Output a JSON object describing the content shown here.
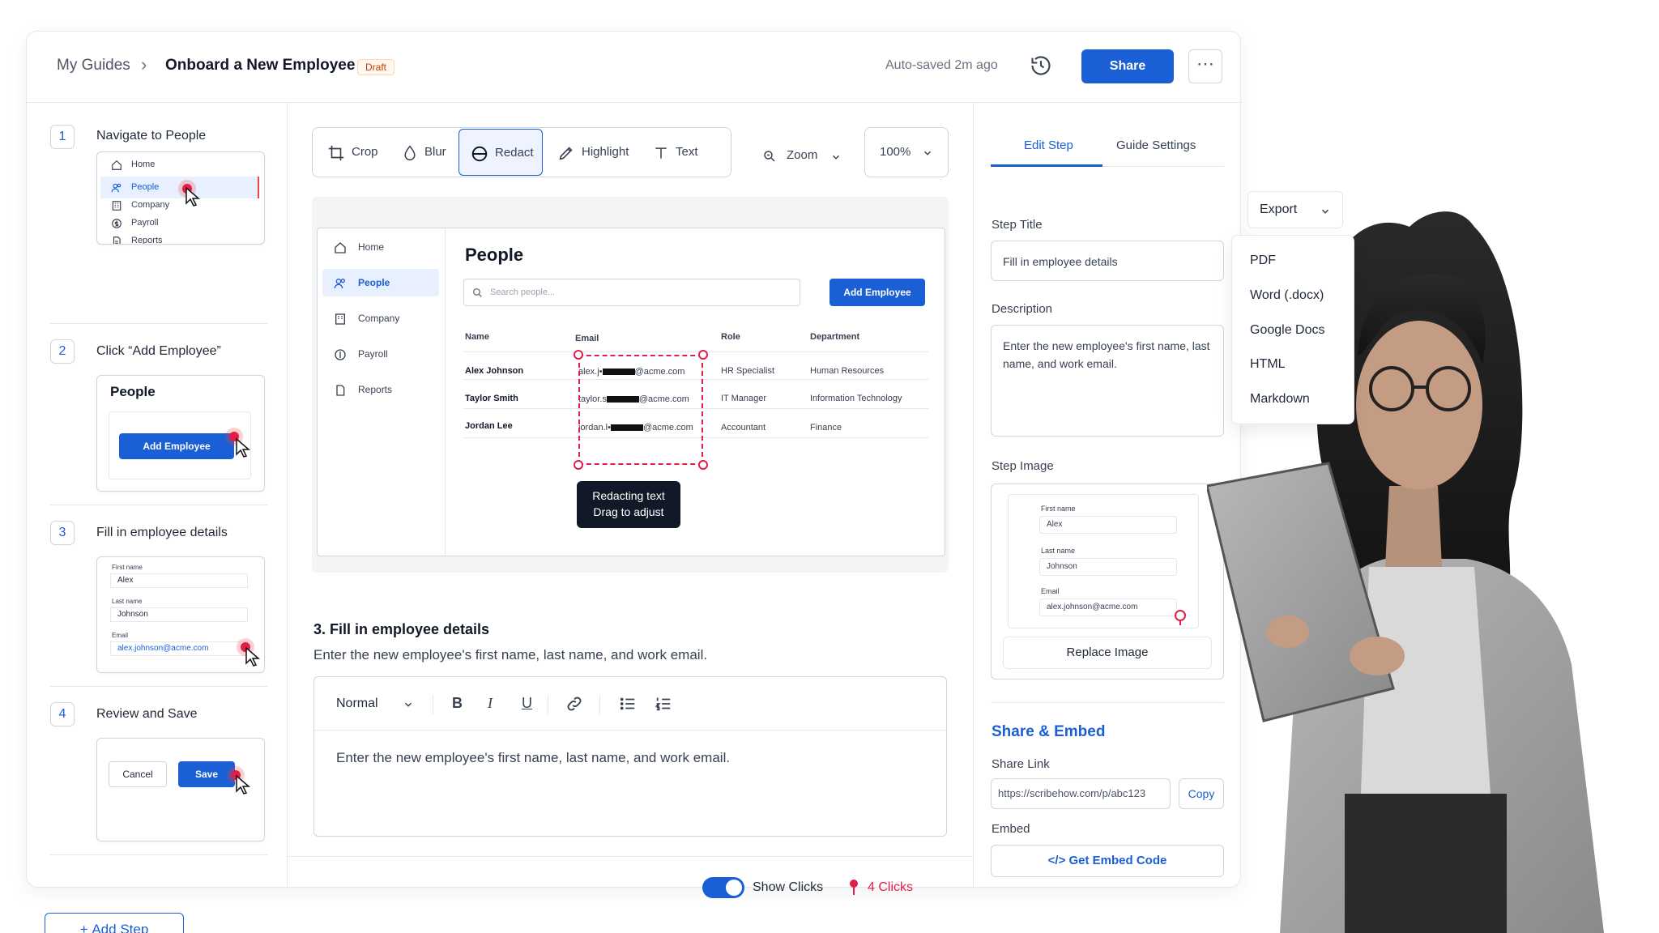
{
  "header": {
    "breadcrumb_root": "My Guides",
    "breadcrumb_sep": "›",
    "guide_title": "Onboard a New Employee",
    "status_badge": "Draft",
    "autosave": "Auto-saved 2m ago",
    "share_label": "Share",
    "more_label": "⋯"
  },
  "steps": [
    {
      "num": "1",
      "label": "Navigate to People"
    },
    {
      "num": "2",
      "label": "Click “Add Employee”"
    },
    {
      "num": "3",
      "label": "Fill in employee details"
    },
    {
      "num": "4",
      "label": "Review and Save"
    }
  ],
  "thumb1": {
    "items": [
      "Home",
      "People",
      "Company",
      "Payroll",
      "Reports"
    ]
  },
  "thumb2": {
    "title": "People",
    "button": "Add Employee"
  },
  "thumb3": {
    "fields": [
      {
        "label": "First name",
        "value": "Alex"
      },
      {
        "label": "Last name",
        "value": "Johnson"
      },
      {
        "label": "Email",
        "value": "alex.johnson@acme.com"
      }
    ]
  },
  "thumb4": {
    "cancel": "Cancel",
    "save": "Save"
  },
  "add_step_label": "Add Step",
  "toolbar": {
    "tools": [
      "Crop",
      "Blur",
      "Redact",
      "Highlight",
      "Text"
    ],
    "active_tool": "Redact",
    "zoom_label": "Zoom",
    "zoom_value": "100%"
  },
  "screenshot": {
    "nav": [
      "Home",
      "People",
      "Company",
      "Payroll",
      "Reports"
    ],
    "active_nav": "People",
    "title": "People",
    "search_placeholder": "Search people...",
    "add_button": "Add Employee",
    "columns": [
      "Name",
      "Email",
      "Role",
      "Department"
    ],
    "rows": [
      {
        "name": "Alex Johnson",
        "email_pre": "alex.j•",
        "email_post": "@acme.com",
        "role": "HR Specialist",
        "dept": "Human Resources"
      },
      {
        "name": "Taylor Smith",
        "email_pre": "taylor.s",
        "email_post": "@acme.com",
        "role": "IT Manager",
        "dept": "Information Technology"
      },
      {
        "name": "Jordan Lee",
        "email_pre": "jordan.l•",
        "email_post": "@acme.com",
        "role": "Accountant",
        "dept": "Finance"
      }
    ],
    "tooltip_line1": "Redacting text",
    "tooltip_line2": "Drag to adjust"
  },
  "step_detail": {
    "title": "3. Fill in employee details",
    "description": "Enter the new employee's first name, last name, and work email."
  },
  "rich_text": {
    "style": "Normal",
    "body": "Enter the new employee's first name, last name, and work email."
  },
  "footer": {
    "show_clicks_label": "Show Clicks",
    "show_clicks_on": true,
    "clicks_count": "4 Clicks"
  },
  "right_panel": {
    "tabs": [
      "Edit Step",
      "Guide Settings"
    ],
    "active_tab": "Edit Step",
    "step_title_label": "Step Title",
    "step_title_value": "Fill in employee details",
    "description_label": "Description",
    "description_value": "Enter the new employee's first name, last name, and work email.",
    "step_image_label": "Step Image",
    "mini_fields": [
      {
        "label": "First name",
        "value": "Alex"
      },
      {
        "label": "Last name",
        "value": "Johnson"
      },
      {
        "label": "Email",
        "value": "alex.johnson@acme.com"
      }
    ],
    "replace_image": "Replace Image",
    "share_embed_title": "Share & Embed",
    "share_link_label": "Share Link",
    "share_link_value": "https://scribehow.com/p/abc123",
    "copy_label": "Copy",
    "embed_label": "Embed",
    "embed_button": "Get Embed Code"
  },
  "export": {
    "label": "Export",
    "options": [
      "PDF",
      "Word (.docx)",
      "Google Docs",
      "HTML",
      "Markdown"
    ]
  },
  "colors": {
    "accent": "#1a5fd6",
    "click_marker": "#e11d48",
    "draft_badge": "#c2410c"
  }
}
